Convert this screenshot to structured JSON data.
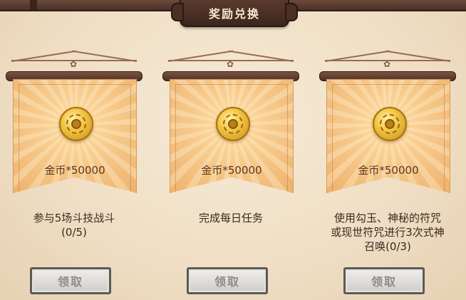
{
  "title": "奖励兑换",
  "cards": [
    {
      "reward_icon": "gold-coin-icon",
      "reward": "金币*50000",
      "desc_line1": "参与5场斗技战斗",
      "desc_line2": "(0/5)",
      "desc_line3": "",
      "button": "领取"
    },
    {
      "reward_icon": "gold-coin-icon",
      "reward": "金币*50000",
      "desc_line1": "完成每日任务",
      "desc_line2": "",
      "desc_line3": "",
      "button": "领取"
    },
    {
      "reward_icon": "gold-coin-icon",
      "reward": "金币*50000",
      "desc_line1": "使用勾玉、神秘的符咒",
      "desc_line2": "或现世符咒进行3次式神",
      "desc_line3": "召唤(0/3)",
      "button": "领取"
    }
  ],
  "colors": {
    "background": "#efdec4",
    "banner": "#f6c98a",
    "title_text": "#f7e8cf",
    "button_disabled": "#cfcdc9"
  }
}
